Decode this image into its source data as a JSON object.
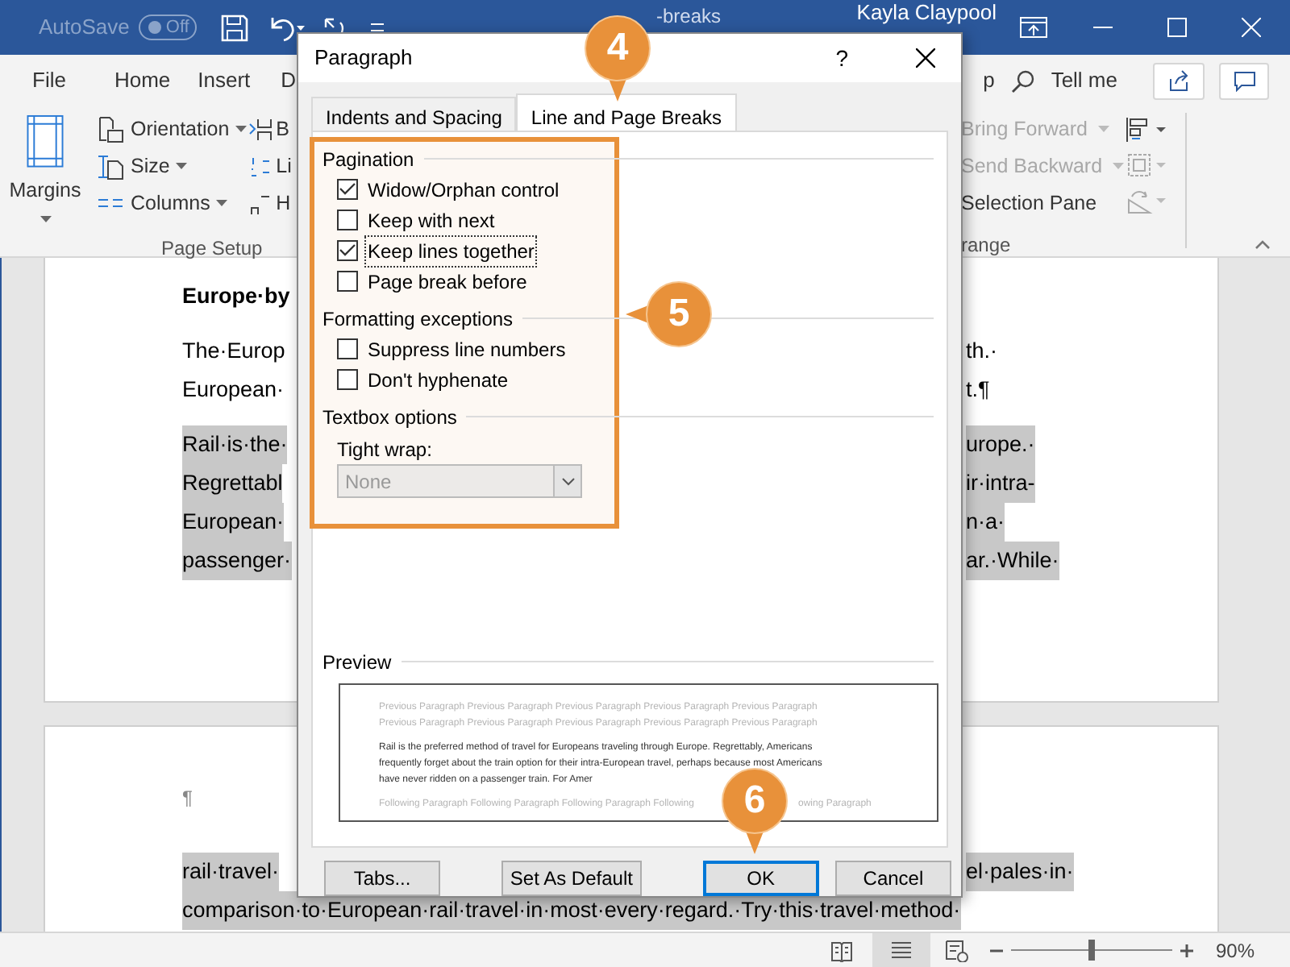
{
  "title_bar": {
    "autosave_label": "AutoSave",
    "autosave_toggle": {
      "label": "Off",
      "on": false
    },
    "document_title": "-breaks",
    "user": "Kayla Claypool"
  },
  "ribbon_tabs": [
    {
      "label": "File"
    },
    {
      "label": "Home"
    },
    {
      "label": "Insert"
    },
    {
      "label": "D"
    }
  ],
  "ribbon_right": {
    "tab_fragment": "p",
    "tell_me": "Tell me"
  },
  "page_setup": {
    "label": "Page Setup",
    "margins": "Margins",
    "items": [
      {
        "label": "Orientation"
      },
      {
        "label": "Size"
      },
      {
        "label": "Columns"
      }
    ],
    "breaks_fragments": [
      "B",
      "Li",
      "H"
    ]
  },
  "arrange": {
    "label": "range",
    "items": [
      {
        "label": "Bring Forward",
        "disabled": true
      },
      {
        "label": "Send Backward",
        "disabled": true
      },
      {
        "label": "Selection Pane",
        "disabled": false
      }
    ]
  },
  "document": {
    "pages": [
      {
        "paragraphs": [
          {
            "kind": "heading",
            "highlighted": false,
            "lines": [
              {
                "left": "Europe·by"
              }
            ]
          },
          {
            "kind": "body",
            "highlighted": false,
            "lines": [
              {
                "left": "The·Europ",
                "right": "th.·"
              },
              {
                "left": "European·",
                "right": "t.¶"
              }
            ]
          },
          {
            "kind": "body",
            "highlighted": true,
            "lines": [
              {
                "left": "Rail·is·the·",
                "right": "urope.·"
              },
              {
                "left": "Regrettabl",
                "right": "ir·intra-"
              },
              {
                "left": "European·",
                "right": "n·a·"
              },
              {
                "left": "passenger·",
                "right": "ar.·While·"
              }
            ]
          }
        ]
      },
      {
        "paragraphs": [
          {
            "kind": "mark",
            "highlighted": false,
            "lines": [
              {
                "left": "¶"
              }
            ]
          },
          {
            "kind": "body",
            "highlighted": true,
            "lines": [
              {
                "left": "rail·travel·",
                "right": "el·pales·in·"
              },
              {
                "left": "comparison·to·European·rail·travel·in·most·every·regard.·Try·this·travel·method·"
              }
            ]
          }
        ]
      }
    ]
  },
  "status_bar": {
    "zoom": {
      "label": "90%",
      "level": 0.5
    }
  },
  "dialog": {
    "title": "Paragraph",
    "help": "?",
    "tabs": [
      {
        "label": "Indents and Spacing",
        "selected": false
      },
      {
        "label": "Line and Page Breaks",
        "selected": true
      }
    ],
    "groups": [
      {
        "title": "Pagination",
        "options": [
          {
            "label": "Widow/Orphan control",
            "checked": true,
            "focused": false
          },
          {
            "label": "Keep with next",
            "checked": false,
            "focused": false
          },
          {
            "label": "Keep lines together",
            "checked": true,
            "focused": true
          },
          {
            "label": "Page break before",
            "checked": false,
            "focused": false
          }
        ]
      },
      {
        "title": "Formatting exceptions",
        "options": [
          {
            "label": "Suppress line numbers",
            "checked": false,
            "focused": false
          },
          {
            "label": "Don't hyphenate",
            "checked": false,
            "focused": false
          }
        ]
      },
      {
        "title": "Textbox options",
        "field": {
          "label": "Tight wrap:",
          "value": "None",
          "disabled": true
        }
      }
    ],
    "preview": {
      "title": "Preview",
      "previous_lines": [
        "Previous Paragraph Previous Paragraph Previous Paragraph Previous Paragraph Previous Paragraph",
        "Previous Paragraph Previous Paragraph Previous Paragraph Previous Paragraph Previous Paragraph"
      ],
      "sample_lines": [
        "Rail is the preferred method of travel for Europeans traveling through Europe. Regrettably, Americans",
        "frequently forget about the train option for their intra-European travel, perhaps because most Americans",
        "have never ridden on a passenger train. For Amer"
      ],
      "following": {
        "left": "Following Paragraph Following Paragraph Following Paragraph Following",
        "right": "owing Paragraph"
      }
    },
    "buttons": [
      {
        "label": "Tabs...",
        "default": false
      },
      {
        "label": "Set As Default",
        "default": false
      },
      {
        "label": "OK",
        "default": true
      },
      {
        "label": "Cancel",
        "default": false
      }
    ]
  },
  "callouts": [
    {
      "number": "4",
      "kind": "below"
    },
    {
      "number": "5",
      "kind": "side"
    },
    {
      "number": "6",
      "kind": "below"
    }
  ]
}
